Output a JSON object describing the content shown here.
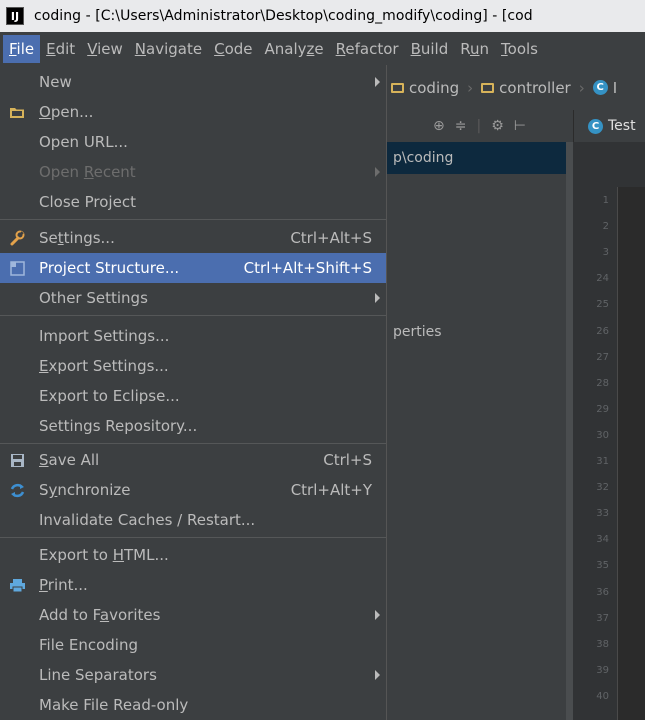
{
  "window": {
    "app_icon_text": "IJ",
    "title": "coding - [C:\\Users\\Administrator\\Desktop\\coding_modify\\coding] - [cod"
  },
  "menubar": [
    {
      "pre": "",
      "u": "F",
      "post": "ile"
    },
    {
      "pre": "",
      "u": "E",
      "post": "dit"
    },
    {
      "pre": "",
      "u": "V",
      "post": "iew"
    },
    {
      "pre": "",
      "u": "N",
      "post": "avigate"
    },
    {
      "pre": "",
      "u": "C",
      "post": "ode"
    },
    {
      "pre": "Analy",
      "u": "z",
      "post": "e"
    },
    {
      "pre": "",
      "u": "R",
      "post": "efactor"
    },
    {
      "pre": "",
      "u": "B",
      "post": "uild"
    },
    {
      "pre": "R",
      "u": "u",
      "post": "n"
    },
    {
      "pre": "",
      "u": "T",
      "post": "ools"
    }
  ],
  "navbar": {
    "crumb1": "coding",
    "crumb2": "controller",
    "crumb3_icon": "C",
    "crumb3": "I"
  },
  "toolstrip": {
    "target_icon": "⊕",
    "collapse_icon": "≑",
    "gear_icon": "⚙",
    "hide_icon": "⊢"
  },
  "editor_tab": {
    "icon": "C",
    "label": "Test"
  },
  "project_tree": {
    "selected_path": "p\\coding",
    "properties_fragment": "perties"
  },
  "line_numbers": [
    "1",
    "2",
    "3",
    "24",
    "25",
    "26",
    "27",
    "28",
    "29",
    "30",
    "31",
    "32",
    "33",
    "34",
    "35",
    "36",
    "37",
    "38",
    "39",
    "40"
  ],
  "file_menu": {
    "new": {
      "pre": "New",
      "u": "",
      "post": ""
    },
    "open": {
      "pre": "",
      "u": "O",
      "post": "pen..."
    },
    "open_url": {
      "pre": "Open URL...",
      "u": "",
      "post": ""
    },
    "open_recent": {
      "pre": "Open ",
      "u": "R",
      "post": "ecent"
    },
    "close_project": {
      "pre": "Close Project",
      "u": "",
      "post": ""
    },
    "settings": {
      "pre": "Se",
      "u": "t",
      "post": "tings...",
      "shortcut": "Ctrl+Alt+S"
    },
    "project_structure": {
      "pre": "Project Structure...",
      "u": "",
      "post": "",
      "shortcut": "Ctrl+Alt+Shift+S"
    },
    "other_settings": {
      "pre": "Other Settings",
      "u": "",
      "post": ""
    },
    "import_settings": {
      "pre": "Import Settings...",
      "u": "",
      "post": ""
    },
    "export_settings": {
      "pre": "",
      "u": "E",
      "post": "xport Settings..."
    },
    "export_eclipse": {
      "pre": "Export to Eclipse...",
      "u": "",
      "post": ""
    },
    "settings_repo": {
      "pre": "Settings Repository...",
      "u": "",
      "post": ""
    },
    "save_all": {
      "pre": "",
      "u": "S",
      "post": "ave All",
      "shortcut": "Ctrl+S"
    },
    "synchronize": {
      "pre": "S",
      "u": "y",
      "post": "nchronize",
      "shortcut": "Ctrl+Alt+Y"
    },
    "invalidate": {
      "pre": "Invalidate Caches / Restart...",
      "u": "",
      "post": ""
    },
    "export_html": {
      "pre": "Export to ",
      "u": "H",
      "post": "TML..."
    },
    "print": {
      "pre": "",
      "u": "P",
      "post": "rint..."
    },
    "add_favorites": {
      "pre": "Add to F",
      "u": "a",
      "post": "vorites"
    },
    "file_encoding": {
      "pre": "File Encoding",
      "u": "",
      "post": ""
    },
    "line_separators": {
      "pre": "Line Separators",
      "u": "",
      "post": ""
    },
    "make_readonly": {
      "pre": "Make File Read-only",
      "u": "",
      "post": ""
    }
  },
  "colors": {
    "menu_bg": "#3c3f41",
    "highlight": "#4b6eaf",
    "editor_bg": "#2b2b2b",
    "folder": "#d7b35a",
    "class_icon": "#3592c4"
  }
}
